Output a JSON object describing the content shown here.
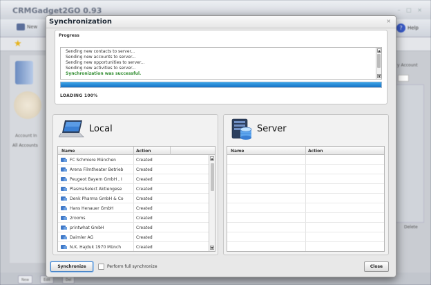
{
  "background": {
    "app_title": "CRMGadget2GO 0.93",
    "toolbar_new": "New",
    "toolbar_help": "Help",
    "account_info": "Account In",
    "all_accounts": "All Accounts",
    "right_label": "y Account",
    "delete_label": "Delete",
    "bottom_buttons": [
      "New",
      "Edit",
      "Del"
    ]
  },
  "dialog": {
    "title": "Synchronization",
    "close_icon": "close-icon"
  },
  "progress": {
    "heading": "Progress",
    "log_lines": [
      "Sending new contacts to server...",
      "Sending new accounts to server...",
      "Sending new opportunities to server...",
      "Sending new activities to server...",
      "Synchronization was successful."
    ],
    "percent": 100,
    "status_text": "LOADING 100%"
  },
  "local": {
    "title": "Local",
    "icon": "laptop-icon",
    "columns": [
      "Name",
      "Action"
    ],
    "rows": [
      {
        "name": "FC Schmiere München",
        "action": "Created"
      },
      {
        "name": "Arena Filmtheater Betrieb",
        "action": "Created"
      },
      {
        "name": "Peugeot Bayern GmbH , I",
        "action": "Created"
      },
      {
        "name": "PlasmaSelect Aktiengese",
        "action": "Created"
      },
      {
        "name": "Denk Pharma GmbH & Co",
        "action": "Created"
      },
      {
        "name": "Hans Henauer GmbH",
        "action": "Created"
      },
      {
        "name": "2rooms",
        "action": "Created"
      },
      {
        "name": "printwhat GmbH",
        "action": "Created"
      },
      {
        "name": "Daimler AG",
        "action": "Created"
      },
      {
        "name": "N.K. Hajduk 1970 Münch",
        "action": "Created"
      }
    ]
  },
  "server": {
    "title": "Server",
    "icon": "server-database-icon",
    "columns": [
      "Name",
      "Action"
    ],
    "rows": []
  },
  "footer": {
    "sync_label": "Synchronize",
    "full_sync_label": "Perform full synchronize",
    "full_sync_checked": false,
    "close_label": "Close"
  },
  "colors": {
    "progress_fill": "#1e88e5",
    "success_text": "#2e8b2e",
    "focus_border": "#4a86c8"
  }
}
